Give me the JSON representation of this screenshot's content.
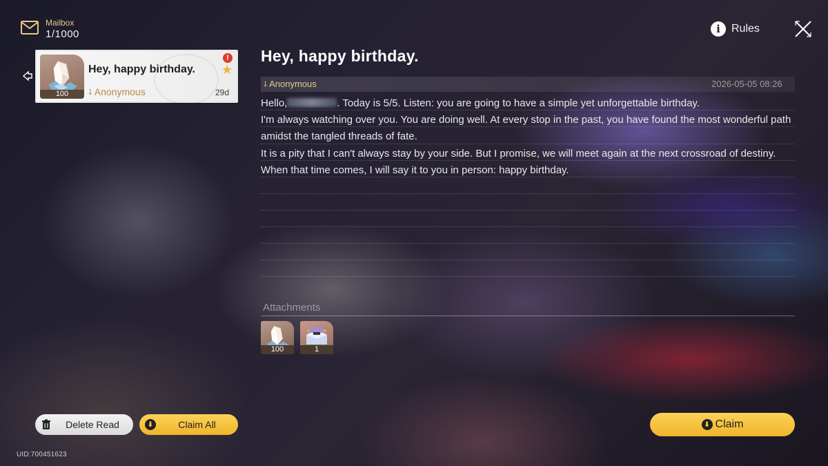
{
  "header": {
    "mailbox_title": "Mailbox",
    "mailbox_count": "1/1000",
    "rules_label": "Rules",
    "icons": {
      "mail": "envelope-icon",
      "info": "info-icon",
      "close": "close-icon"
    }
  },
  "mail_list": [
    {
      "title": "Hey, happy birthday.",
      "sender": "Anonymous",
      "age": "29d",
      "thumb_qty": "100",
      "unread_alert": "!",
      "starred": true,
      "selected": true
    }
  ],
  "detail": {
    "title": "Hey, happy birthday.",
    "sender": "Anonymous",
    "date": "2026-05-05 08:26",
    "greeting": "Hello,",
    "line1_rest": ". Today is 5/5. Listen: you are going to have a simple yet unforgettable birthday.",
    "line2": "I'm always watching over you. You are doing well. At every stop in the past, you have found the most wonderful path amidst the tangled threads of fate.",
    "line3": "It is a pity that I can't always stay by your side. But I promise, we will meet again at the next crossroad of destiny.",
    "line4": "When that time comes, I will say it to you in person: happy birthday."
  },
  "attachments": {
    "label": "Attachments",
    "items": [
      {
        "name": "crystal",
        "qty": "100"
      },
      {
        "name": "cake",
        "qty": "1"
      }
    ]
  },
  "buttons": {
    "delete_read": "Delete Read",
    "claim_all": "Claim All",
    "claim": "Claim"
  },
  "footer": {
    "uid": "UID:700451623"
  },
  "colors": {
    "accent_yellow": "#f5c53c",
    "sender_gold": "#e8c98a",
    "alert_red": "#e03a2f"
  }
}
